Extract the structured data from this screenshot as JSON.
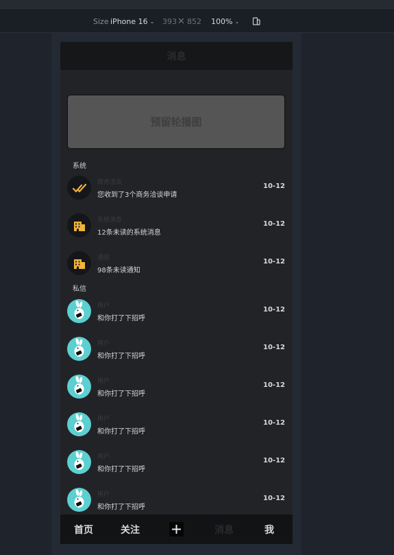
{
  "devtools": {
    "size_label": "Size",
    "device": "iPhone 16",
    "width": "393",
    "x": "✕",
    "height": "852",
    "zoom": "100%"
  },
  "app": {
    "title": "消息",
    "banner": "预留轮播图",
    "sections": {
      "system": "系统",
      "private": "私信"
    },
    "system_items": [
      {
        "name": "商务洽谈",
        "message": "您收到了3个商务洽谈申请",
        "time": "10-12",
        "icon": "double-check-icon"
      },
      {
        "name": "系统消息",
        "message": "12条未读的系统消息",
        "time": "10-12",
        "icon": "building-icon"
      },
      {
        "name": "通知",
        "message": "98条未读通知",
        "time": "10-12",
        "icon": "building-icon"
      }
    ],
    "private_items": [
      {
        "name": "用户",
        "message": "和你打了下招呼",
        "time": "10-12"
      },
      {
        "name": "用户",
        "message": "和你打了下招呼",
        "time": "10-12"
      },
      {
        "name": "用户",
        "message": "和你打了下招呼",
        "time": "10-12"
      },
      {
        "name": "用户",
        "message": "和你打了下招呼",
        "time": "10-12"
      },
      {
        "name": "用户",
        "message": "和你打了下招呼",
        "time": "10-12"
      },
      {
        "name": "用户",
        "message": "和你打了下招呼",
        "time": "10-12"
      }
    ],
    "tabs": {
      "home": "首页",
      "follow": "关注",
      "messages": "消息",
      "me": "我"
    }
  },
  "colors": {
    "accent_icon": "#f0b43a",
    "avatar_teal": "#5ccfd0"
  }
}
